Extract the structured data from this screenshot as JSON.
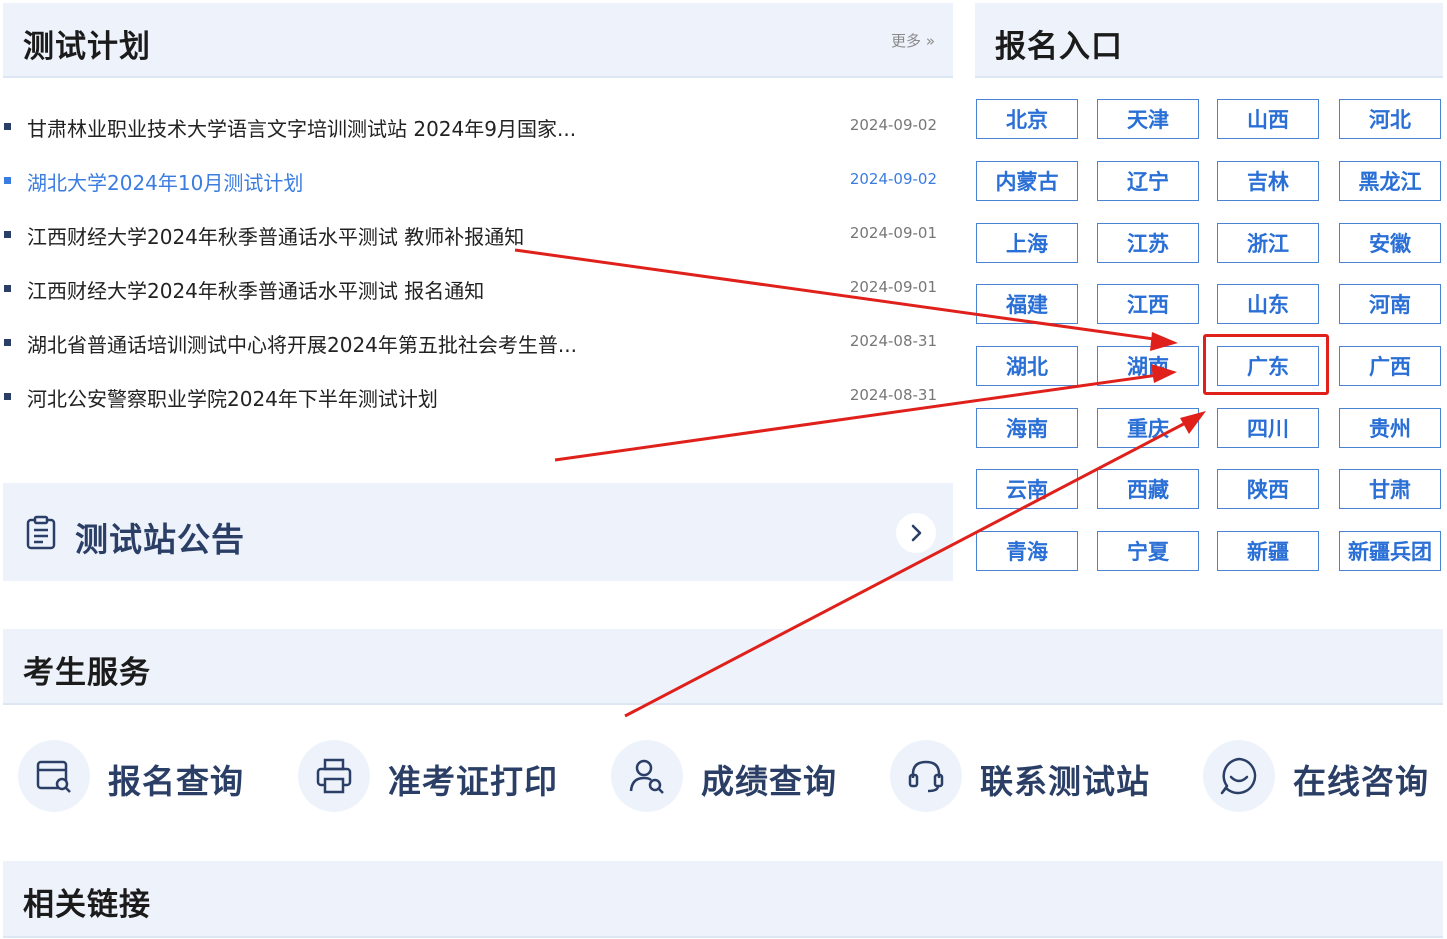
{
  "test_plan": {
    "title": "测试计划",
    "more_label": "更多 »",
    "items": [
      {
        "title": "甘肃林业职业技术大学语言文字培训测试站 2024年9月国家...",
        "date": "2024-09-02"
      },
      {
        "title": "湖北大学2024年10月测试计划",
        "date": "2024-09-02"
      },
      {
        "title": "江西财经大学2024年秋季普通话水平测试 教师补报通知",
        "date": "2024-09-01"
      },
      {
        "title": "江西财经大学2024年秋季普通话水平测试 报名通知",
        "date": "2024-09-01"
      },
      {
        "title": "湖北省普通话培训测试中心将开展2024年第五批社会考生普...",
        "date": "2024-08-31"
      },
      {
        "title": "河北公安警察职业学院2024年下半年测试计划",
        "date": "2024-08-31"
      }
    ]
  },
  "notice": {
    "title": "测试站公告"
  },
  "registration": {
    "title": "报名入口",
    "provinces": [
      "北京",
      "天津",
      "山西",
      "河北",
      "内蒙古",
      "辽宁",
      "吉林",
      "黑龙江",
      "上海",
      "江苏",
      "浙江",
      "安徽",
      "福建",
      "江西",
      "山东",
      "河南",
      "湖北",
      "湖南",
      "广东",
      "广西",
      "海南",
      "重庆",
      "四川",
      "贵州",
      "云南",
      "西藏",
      "陕西",
      "甘肃",
      "青海",
      "宁夏",
      "新疆",
      "新疆兵团"
    ]
  },
  "services": {
    "title": "考生服务",
    "items": [
      {
        "label": "报名查询",
        "icon": "registration-query-icon"
      },
      {
        "label": "准考证打印",
        "icon": "printer-icon"
      },
      {
        "label": "成绩查询",
        "icon": "user-search-icon"
      },
      {
        "label": "联系测试站",
        "icon": "headset-icon"
      },
      {
        "label": "在线咨询",
        "icon": "chat-bubble-icon"
      }
    ]
  },
  "links": {
    "title": "相关链接"
  },
  "colors": {
    "accent": "#3b7ce0",
    "annotation": "#e0201b",
    "panel_bg": "#eef3fb",
    "dark_text": "#2b3f66"
  }
}
